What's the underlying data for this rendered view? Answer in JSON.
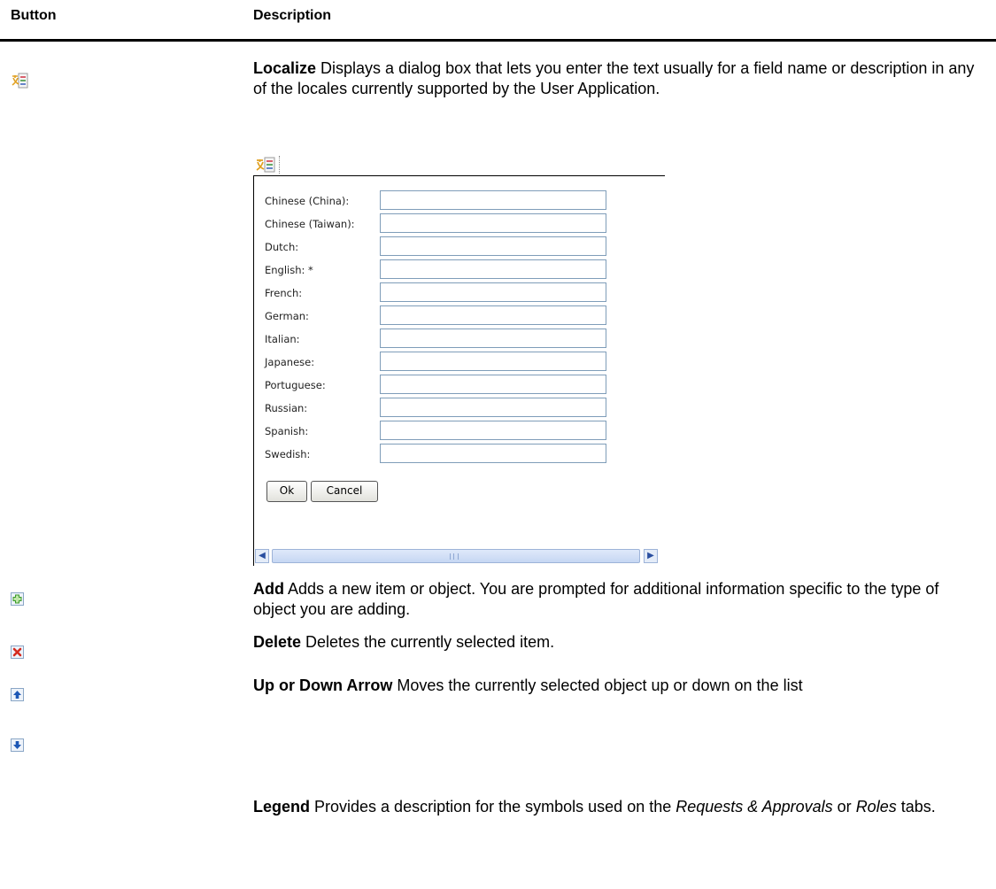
{
  "table": {
    "header_button": "Button",
    "header_description": "Description",
    "rows": [
      {
        "icon": "localize-icon",
        "title": "Localize",
        "text": " Displays a dialog box that lets you enter the text usually for a field name or description in any of the locales currently supported by the User Application."
      },
      {
        "icon": "add-icon",
        "title": "Add",
        "text": " Adds a new item or object. You are prompted for additional information specific to the type of object you are adding."
      },
      {
        "icon": "delete-icon",
        "title": "Delete",
        "text": " Deletes the currently selected item."
      },
      {
        "icon": "up-arrow-icon",
        "title": "Up or Down Arrow",
        "text": " Moves the currently selected object up or down on the list"
      },
      {
        "icon": "down-arrow-icon"
      },
      {
        "title": "Legend",
        "text_1": " Provides a description for the symbols used on the ",
        "em_1": "Requests & Approvals",
        "text_2": " or ",
        "em_2": "Roles",
        "text_3": " tabs."
      }
    ]
  },
  "dialog": {
    "locales": [
      {
        "label": "Chinese (China):",
        "value": ""
      },
      {
        "label": "Chinese (Taiwan):",
        "value": ""
      },
      {
        "label": "Dutch:",
        "value": ""
      },
      {
        "label": "English: *",
        "value": ""
      },
      {
        "label": "French:",
        "value": ""
      },
      {
        "label": "German:",
        "value": ""
      },
      {
        "label": "Italian:",
        "value": ""
      },
      {
        "label": "Japanese:",
        "value": ""
      },
      {
        "label": "Portuguese:",
        "value": ""
      },
      {
        "label": "Russian:",
        "value": ""
      },
      {
        "label": "Spanish:",
        "value": ""
      },
      {
        "label": "Swedish:",
        "value": ""
      }
    ],
    "ok_label": "Ok",
    "cancel_label": "Cancel"
  },
  "colors": {
    "add_green": "#3a9a2a",
    "delete_red": "#d42a1e",
    "arrow_blue": "#1d57b5"
  }
}
